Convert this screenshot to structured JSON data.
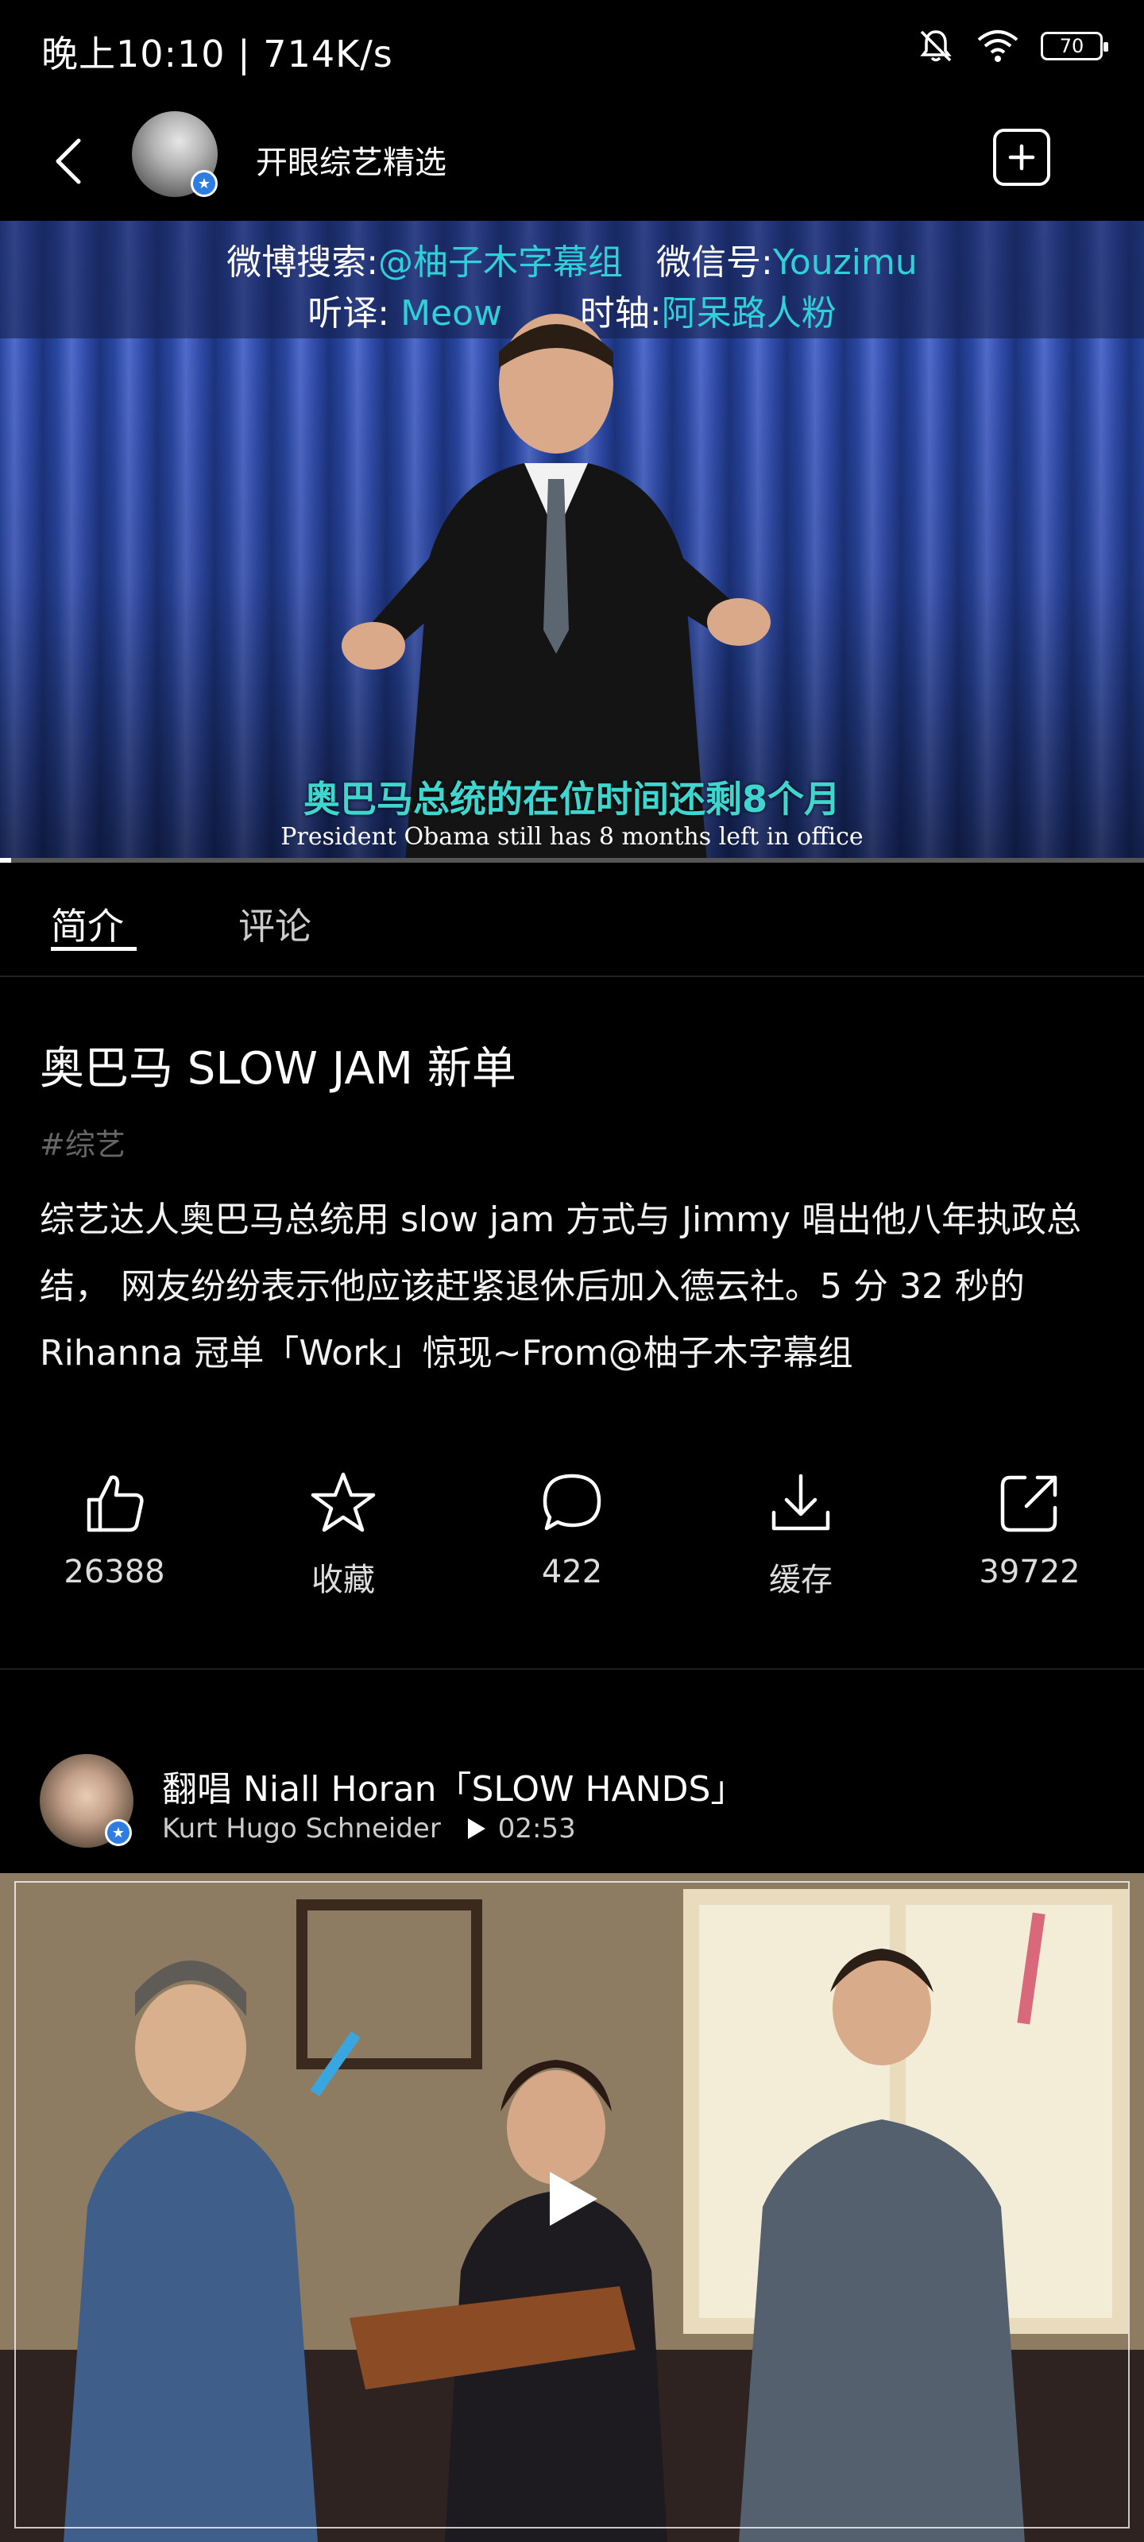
{
  "status_bar": {
    "time_speed": "晚上10:10 | 714K/s",
    "battery": "70",
    "icons": [
      "mute-bell-icon",
      "wifi-icon",
      "battery-icon"
    ]
  },
  "header": {
    "back_icon": "chevron-left-icon",
    "channel_name": "开眼综艺精选",
    "add_icon": "plus-square-icon"
  },
  "video": {
    "credit_line1_prefix": "微博搜索:",
    "credit_line1_weibo": "@柚子木字幕组",
    "credit_line1_wechat_prefix": "微信号:",
    "credit_line1_wechat": "Youzimu",
    "credit_line2_listen_prefix": "听译: ",
    "credit_line2_listen": "Meow",
    "credit_line2_timing_prefix": "时轴:",
    "credit_line2_timing": "阿呆路人粉",
    "subtitle_cn": "奥巴马总统的在位时间还剩8个月",
    "subtitle_en": "President Obama still has 8 months left in office",
    "progress": 0.01
  },
  "tabs": {
    "intro": "简介",
    "comments": "评论"
  },
  "intro": {
    "title": "奥巴马 SLOW JAM 新单",
    "tag": "#综艺",
    "description": "综艺达人奥巴马总统用 slow jam 方式与 Jimmy 唱出他八年执政总结， 网友纷纷表示他应该赶紧退休后加入德云社。5 分 32 秒的 Rihanna 冠单「Work」惊现~From@柚子木字幕组"
  },
  "actions": {
    "like_count": "26388",
    "favorite_label": "收藏",
    "comment_count": "422",
    "download_label": "缓存",
    "share_count": "39722"
  },
  "related": {
    "title": "翻唱 Niall Horan「SLOW HANDS」",
    "author": "Kurt Hugo Schneider",
    "duration": "02:53"
  },
  "colors": {
    "accent_cyan": "#2fd0d8",
    "verify_blue": "#2f7de0",
    "background": "#000000"
  }
}
